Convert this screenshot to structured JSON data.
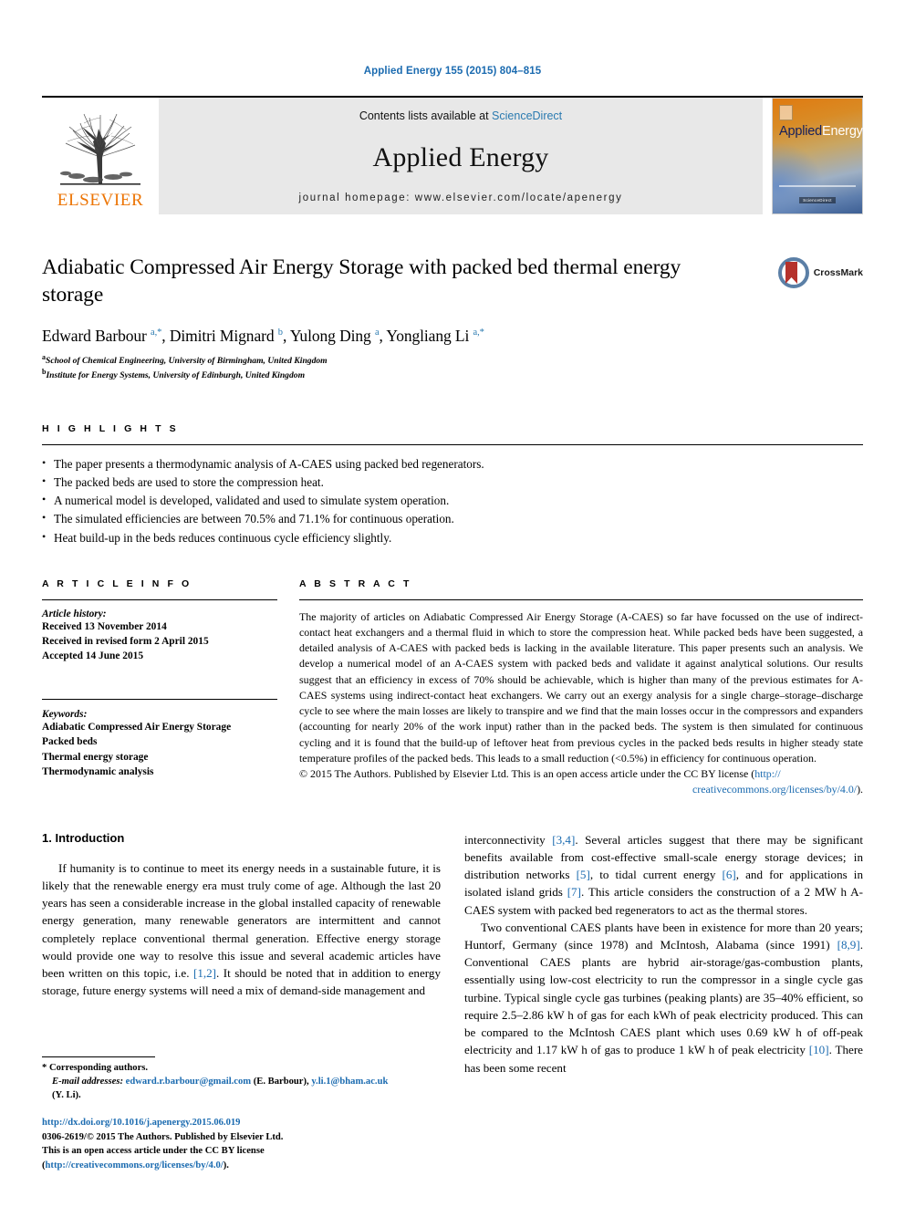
{
  "journal_ref": "Applied Energy 155 (2015) 804–815",
  "masthead": {
    "publisher": "ELSEVIER",
    "contents_prefix": "Contents lists available at ",
    "contents_link": "ScienceDirect",
    "journal_title": "Applied Energy",
    "homepage": "journal homepage: www.elsevier.com/locate/apenergy",
    "cover": {
      "title_part1": "Applied",
      "title_part2": "Energy",
      "badge": "ScienceDirect"
    }
  },
  "article": {
    "title": "Adiabatic Compressed Air Energy Storage with packed bed thermal energy storage",
    "crossmark_label": "CrossMark",
    "authors_html": "Edward Barbour <sup>a,*</sup>, Dimitri Mignard <sup>b</sup>, Yulong Ding <sup>a</sup>, Yongliang Li <sup>a,*</sup>",
    "affiliations": [
      {
        "marker": "a",
        "text": "School of Chemical Engineering, University of Birmingham, United Kingdom"
      },
      {
        "marker": "b",
        "text": "Institute for Energy Systems, University of Edinburgh, United Kingdom"
      }
    ]
  },
  "highlights": {
    "label": "H I G H L I G H T S",
    "items": [
      "The paper presents a thermodynamic analysis of A-CAES using packed bed regenerators.",
      "The packed beds are used to store the compression heat.",
      "A numerical model is developed, validated and used to simulate system operation.",
      "The simulated efficiencies are between 70.5% and 71.1% for continuous operation.",
      "Heat build-up in the beds reduces continuous cycle efficiency slightly."
    ]
  },
  "article_info": {
    "label": "A R T I C L E    I N F O",
    "history_title": "Article history:",
    "history": [
      "Received 13 November 2014",
      "Received in revised form 2 April 2015",
      "Accepted 14 June 2015"
    ],
    "keywords_title": "Keywords:",
    "keywords": [
      "Adiabatic Compressed Air Energy Storage",
      "Packed beds",
      "Thermal energy storage",
      "Thermodynamic analysis"
    ]
  },
  "abstract": {
    "label": "A B S T R A C T",
    "text": "The majority of articles on Adiabatic Compressed Air Energy Storage (A-CAES) so far have focussed on the use of indirect-contact heat exchangers and a thermal fluid in which to store the compression heat. While packed beds have been suggested, a detailed analysis of A-CAES with packed beds is lacking in the available literature. This paper presents such an analysis. We develop a numerical model of an A-CAES system with packed beds and validate it against analytical solutions. Our results suggest that an efficiency in excess of 70% should be achievable, which is higher than many of the previous estimates for A-CAES systems using indirect-contact heat exchangers. We carry out an exergy analysis for a single charge–storage–discharge cycle to see where the main losses are likely to transpire and we find that the main losses occur in the compressors and expanders (accounting for nearly 20% of the work input) rather than in the packed beds. The system is then simulated for continuous cycling and it is found that the build-up of leftover heat from previous cycles in the packed beds results in higher steady state temperature profiles of the packed beds. This leads to a small reduction (<0.5%) in efficiency for continuous operation.",
    "copyright_prefix": "© 2015 The Authors. Published by Elsevier Ltd. This is an open access article under the CC BY license (",
    "copyright_link_1": "http://",
    "copyright_link_2": "creativecommons.org/licenses/by/4.0/",
    "copyright_suffix": ")."
  },
  "introduction": {
    "heading": "1. Introduction",
    "left_paragraph_a": "If humanity is to continue to meet its energy needs in a sustainable future, it is likely that the renewable energy era must truly come of age. Although the last 20 years has seen a considerable increase in the global installed capacity of renewable energy generation, many renewable generators are intermittent and cannot completely replace conventional thermal generation. Effective energy storage would provide one way to resolve this issue and several academic articles have been written on this topic, i.e. ",
    "left_cite_12": "[1,2]",
    "left_paragraph_b": ". It should be noted that in addition to energy storage, future energy systems will need a mix of demand-side management and ",
    "right_paragraph_a_lead": "interconnectivity ",
    "right_cite_34": "[3,4]",
    "right_paragraph_a_mid": ". Several articles suggest that there may be significant benefits available from cost-effective small-scale energy storage devices; in distribution networks ",
    "right_cite_5": "[5]",
    "right_paragraph_a_mid2": ", to tidal current energy ",
    "right_cite_6": "[6]",
    "right_paragraph_a_mid3": ", and for applications in isolated island grids ",
    "right_cite_7": "[7]",
    "right_paragraph_a_end": ". This article considers the construction of a 2 MW h A-CAES system with packed bed regenerators to act as the thermal stores.",
    "right_paragraph_b_lead": "Two conventional CAES plants have been in existence for more than 20 years; Huntorf, Germany (since 1978) and McIntosh, Alabama (since 1991) ",
    "right_cite_89": "[8,9]",
    "right_paragraph_b_mid": ". Conventional CAES plants are hybrid air-storage/gas-combustion plants, essentially using low-cost electricity to run the compressor in a single cycle gas turbine. Typical single cycle gas turbines (peaking plants) are 35–40% efficient, so require 2.5–2.86 kW h of gas for each kWh of peak electricity produced. This can be compared to the McIntosh CAES plant which uses 0.69 kW h of off-peak electricity and 1.17 kW h of gas to produce 1 kW h of peak electricity ",
    "right_cite_10": "[10]",
    "right_paragraph_b_end": ". There has been some recent"
  },
  "footnotes": {
    "corresponding": "* Corresponding authors.",
    "email_label": "E-mail addresses:",
    "email_1": "edward.r.barbour@gmail.com",
    "email_1_owner": " (E. Barbour), ",
    "email_2": "y.li.1@bham.ac.uk",
    "email_2_owner": "(Y. Li)."
  },
  "footer": {
    "doi": "http://dx.doi.org/10.1016/j.apenergy.2015.06.019",
    "issn_line": "0306-2619/© 2015 The Authors. Published by Elsevier Ltd.",
    "license_prefix": "This is an open access article under the CC BY license (",
    "license_link": "http://creativecommons.org/licenses/by/4.0/",
    "license_suffix": ")."
  },
  "colors": {
    "link_blue": "#1b6bb0",
    "elsevier_orange": "#ec7404",
    "cover_orange": "#e07a10",
    "crossmark_red": "#b5322c",
    "crossmark_blue": "#5b7fa6"
  }
}
